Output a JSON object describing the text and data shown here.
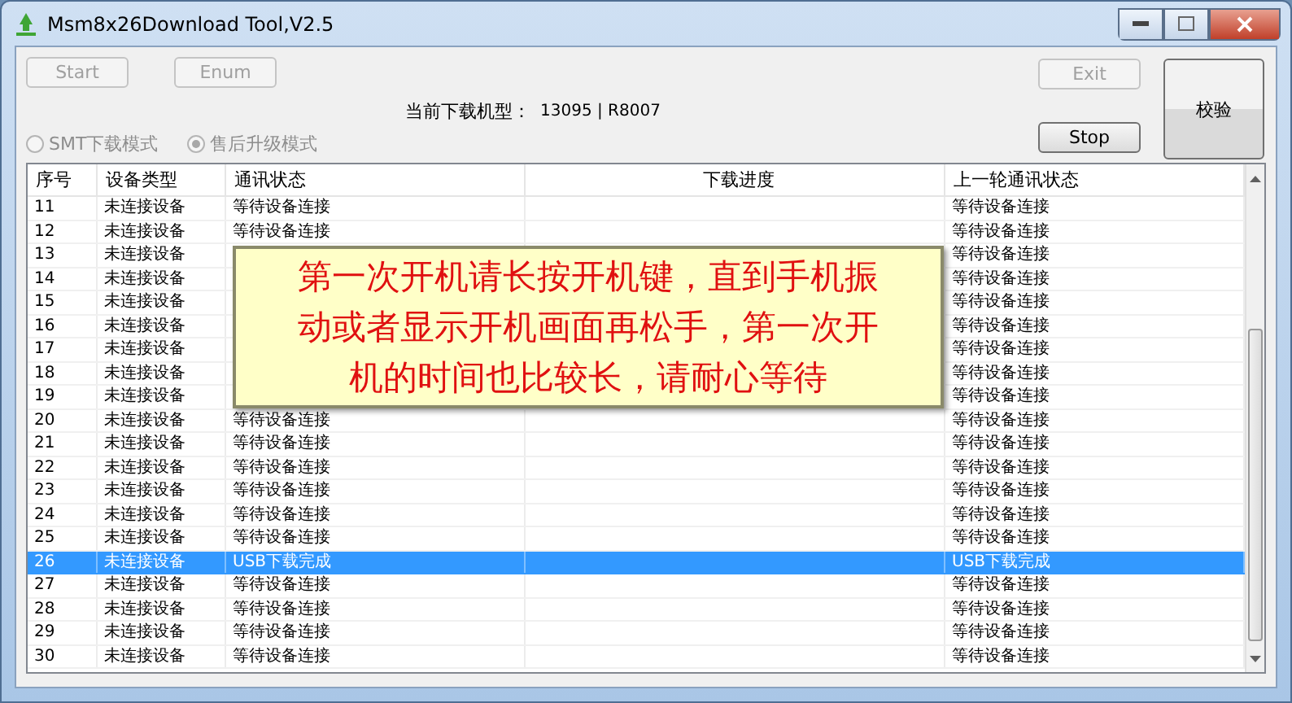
{
  "window": {
    "title": "Msm8x26Download Tool,V2.5"
  },
  "buttons": [
    {
      "label": "Start",
      "disabled": true
    },
    {
      "label": "Enum",
      "disabled": true
    }
  ],
  "model": {
    "label": "当前下载机型：",
    "value": "13095 | R8007"
  },
  "modes": [
    {
      "label": "SMT下载模式",
      "selected": false
    },
    {
      "label": "售后升级模式",
      "selected": true
    }
  ],
  "right_buttons": [
    {
      "label": "Exit",
      "disabled": true
    },
    {
      "label": "Stop",
      "disabled": false
    }
  ],
  "verify_button": {
    "label": "校验"
  },
  "table": {
    "columns": [
      "序号",
      "设备类型",
      "通讯状态",
      "下载进度",
      "上一轮通讯状态"
    ],
    "rows": [
      {
        "cells": [
          "11",
          "未连接设备",
          "等待设备连接",
          "",
          "等待设备连接"
        ],
        "selected": false
      },
      {
        "cells": [
          "12",
          "未连接设备",
          "等待设备连接",
          "",
          "等待设备连接"
        ],
        "selected": false
      },
      {
        "cells": [
          "13",
          "未连接设备",
          "",
          "",
          "等待设备连接"
        ],
        "selected": false
      },
      {
        "cells": [
          "14",
          "未连接设备",
          "",
          "",
          "等待设备连接"
        ],
        "selected": false
      },
      {
        "cells": [
          "15",
          "未连接设备",
          "",
          "",
          "等待设备连接"
        ],
        "selected": false
      },
      {
        "cells": [
          "16",
          "未连接设备",
          "",
          "",
          "等待设备连接"
        ],
        "selected": false
      },
      {
        "cells": [
          "17",
          "未连接设备",
          "",
          "",
          "等待设备连接"
        ],
        "selected": false
      },
      {
        "cells": [
          "18",
          "未连接设备",
          "",
          "",
          "等待设备连接"
        ],
        "selected": false
      },
      {
        "cells": [
          "19",
          "未连接设备",
          "",
          "",
          "等待设备连接"
        ],
        "selected": false
      },
      {
        "cells": [
          "20",
          "未连接设备",
          "等待设备连接",
          "",
          "等待设备连接"
        ],
        "selected": false
      },
      {
        "cells": [
          "21",
          "未连接设备",
          "等待设备连接",
          "",
          "等待设备连接"
        ],
        "selected": false
      },
      {
        "cells": [
          "22",
          "未连接设备",
          "等待设备连接",
          "",
          "等待设备连接"
        ],
        "selected": false
      },
      {
        "cells": [
          "23",
          "未连接设备",
          "等待设备连接",
          "",
          "等待设备连接"
        ],
        "selected": false
      },
      {
        "cells": [
          "24",
          "未连接设备",
          "等待设备连接",
          "",
          "等待设备连接"
        ],
        "selected": false
      },
      {
        "cells": [
          "25",
          "未连接设备",
          "等待设备连接",
          "",
          "等待设备连接"
        ],
        "selected": false
      },
      {
        "cells": [
          "26",
          "未连接设备",
          "USB下载完成",
          "",
          "USB下载完成"
        ],
        "selected": true
      },
      {
        "cells": [
          "27",
          "未连接设备",
          "等待设备连接",
          "",
          "等待设备连接"
        ],
        "selected": false
      },
      {
        "cells": [
          "28",
          "未连接设备",
          "等待设备连接",
          "",
          "等待设备连接"
        ],
        "selected": false
      },
      {
        "cells": [
          "29",
          "未连接设备",
          "等待设备连接",
          "",
          "等待设备连接"
        ],
        "selected": false
      },
      {
        "cells": [
          "30",
          "未连接设备",
          "等待设备连接",
          "",
          "等待设备连接"
        ],
        "selected": false
      }
    ]
  },
  "notice": {
    "lines": [
      "第一次开机请长按开机键，直到手机振",
      "动或者显示开机画面再松手，第一次开",
      "机的时间也比较长，请耐心等待"
    ]
  }
}
